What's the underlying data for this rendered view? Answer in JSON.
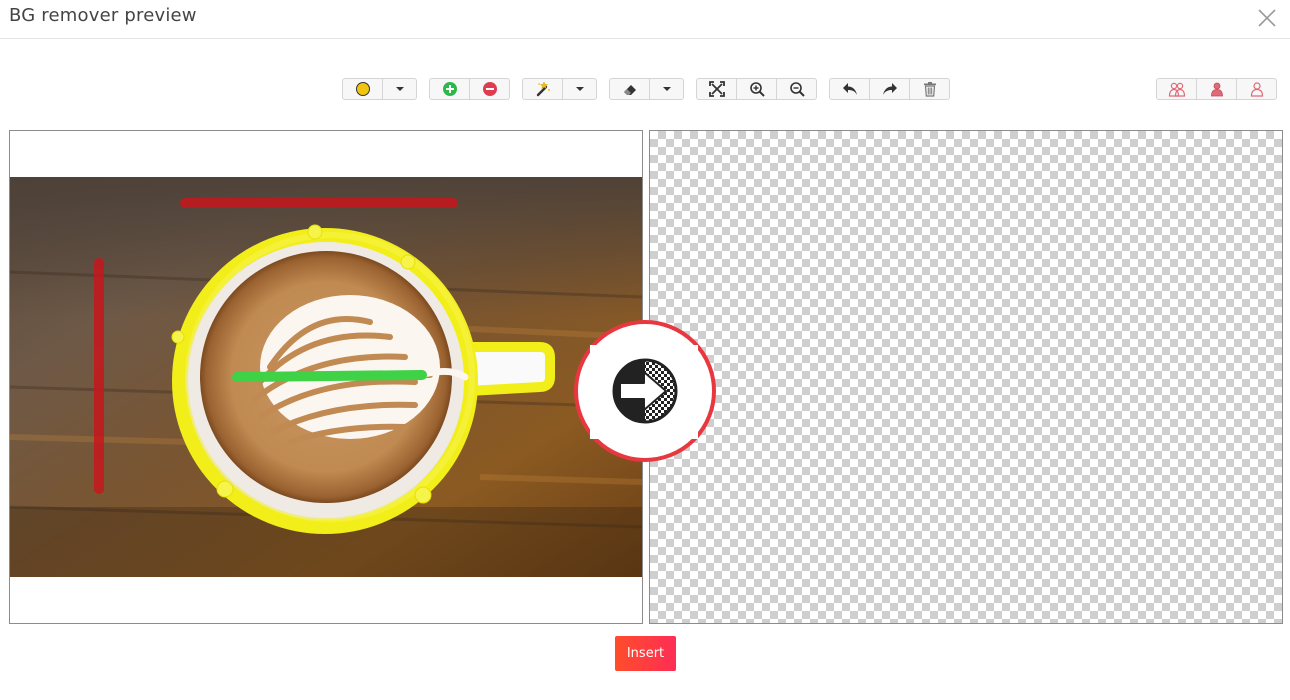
{
  "window": {
    "title": "BG remover preview"
  },
  "toolbar": {
    "groups": [
      {
        "name": "color",
        "items": [
          "color-swatch-icon",
          "chevron-down-icon"
        ],
        "swatch_color": "#f1c40f"
      },
      {
        "name": "mark",
        "items": [
          "plus-circle-icon",
          "minus-circle-icon"
        ],
        "keep_color": "#2db84a",
        "remove_color": "#e03c4f"
      },
      {
        "name": "magic",
        "items": [
          "magic-wand-icon",
          "chevron-down-icon"
        ]
      },
      {
        "name": "eraser",
        "items": [
          "eraser-icon",
          "chevron-down-icon"
        ]
      },
      {
        "name": "view",
        "items": [
          "fit-screen-icon",
          "zoom-in-icon",
          "zoom-out-icon"
        ]
      },
      {
        "name": "history",
        "items": [
          "undo-icon",
          "redo-icon",
          "trash-icon"
        ]
      },
      {
        "name": "subject",
        "items": [
          "people-icon",
          "person-icon",
          "person-outline-icon"
        ],
        "accent_color": "#e06a78"
      }
    ]
  },
  "canvas": {
    "keep_stroke_color": "#3fd146",
    "remove_stroke_color": "#c8161c",
    "outline_color": "#f2ee1a"
  },
  "actions": {
    "insert_label": "Insert",
    "insert_colors": [
      "#ff4d2b",
      "#ff2d55"
    ]
  },
  "badge": {
    "ring_color": "#e8373f"
  }
}
